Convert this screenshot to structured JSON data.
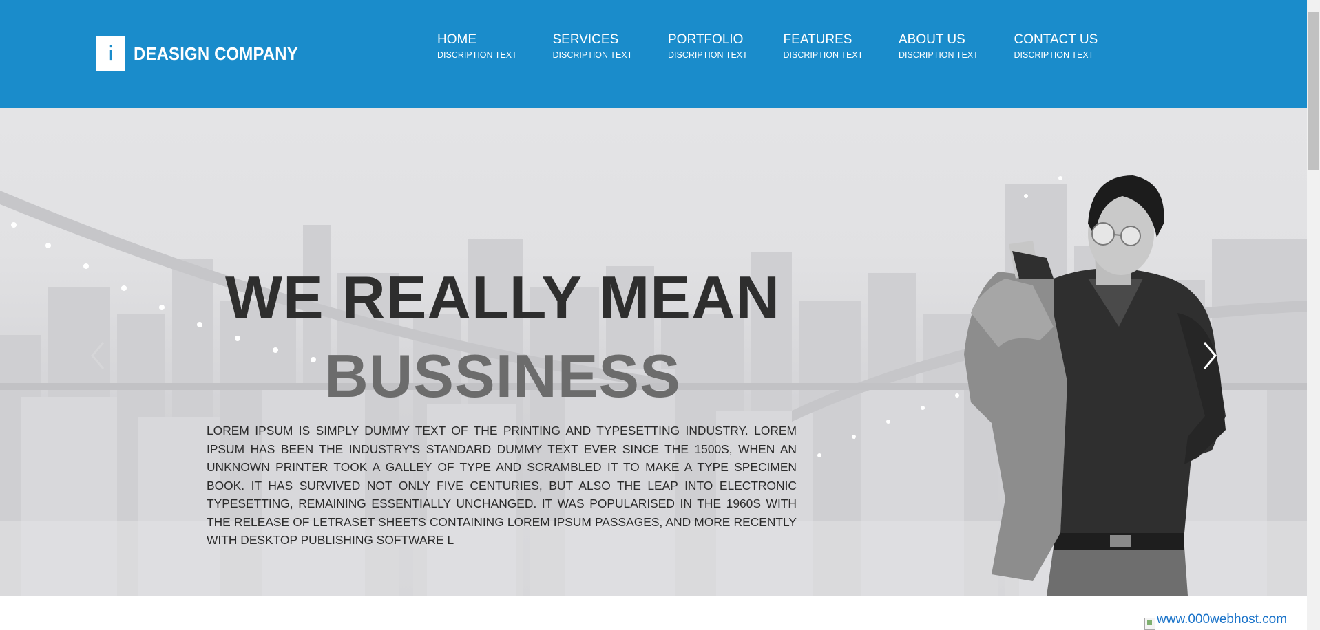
{
  "header": {
    "logo_mark": "i",
    "brand": "DEASIGN COMPANY",
    "nav": [
      {
        "label": "HOME",
        "sub": "DISCRIPTION TEXT"
      },
      {
        "label": "SERVICES",
        "sub": "DISCRIPTION TEXT"
      },
      {
        "label": "PORTFOLIO",
        "sub": "DISCRIPTION TEXT"
      },
      {
        "label": "FEATURES",
        "sub": "DISCRIPTION TEXT"
      },
      {
        "label": "ABOUT US",
        "sub": "DISCRIPTION TEXT"
      },
      {
        "label": "CONTACT US",
        "sub": "DISCRIPTION TEXT"
      }
    ]
  },
  "hero": {
    "title_line1": "WE REALLY MEAN",
    "title_line2": "BUSSINESS",
    "body": "LOREM IPSUM IS SIMPLY DUMMY TEXT OF THE PRINTING AND TYPESETTING INDUSTRY. LOREM IPSUM HAS BEEN THE INDUSTRY'S STANDARD DUMMY TEXT EVER SINCE THE 1500S, WHEN AN UNKNOWN PRINTER TOOK A GALLEY OF TYPE AND SCRAMBLED IT TO MAKE A TYPE SPECIMEN BOOK. IT HAS SURVIVED NOT ONLY FIVE CENTURIES, BUT ALSO THE LEAP INTO ELECTRONIC TYPESETTING, REMAINING ESSENTIALLY UNCHANGED. IT WAS POPULARISED IN THE 1960S WITH THE RELEASE OF LETRASET SHEETS CONTAINING LOREM IPSUM PASSAGES, AND MORE RECENTLY WITH DESKTOP PUBLISHING SOFTWARE L",
    "next_icon": "chevron-right-icon",
    "prev_icon": "chevron-left-icon"
  },
  "footer": {
    "host_link": "www.000webhost.com"
  },
  "colors": {
    "header_bg": "#1a8ccb",
    "title_dark": "#2e2e2e",
    "title_grey": "#6c6c6c",
    "link": "#1a73c9"
  }
}
